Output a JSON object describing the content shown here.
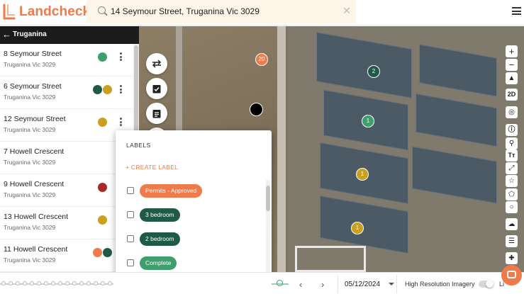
{
  "app": {
    "name": "Landchecker"
  },
  "search": {
    "value": "14 Seymour Street, Truganina Vic 3029",
    "placeholder": ""
  },
  "sidebar": {
    "title": "Truganina",
    "items": [
      {
        "street": "8 Seymour Street",
        "suburb": "Truganina Vic 3029",
        "labels": [
          "#3f9e6d"
        ]
      },
      {
        "street": "6 Seymour Street",
        "suburb": "Truganina Vic 3029",
        "labels": [
          "#1f5a48",
          "#c9a020"
        ]
      },
      {
        "street": "12 Seymour Street",
        "suburb": "Truganina Vic 3029",
        "labels": [
          "#c9a020"
        ]
      },
      {
        "street": "7 Howell Crescent",
        "suburb": "Truganina Vic 3029",
        "labels": []
      },
      {
        "street": "9 Howell Crescent",
        "suburb": "Truganina Vic 3029",
        "labels": [
          "#a72a2a"
        ]
      },
      {
        "street": "13 Howell Crescent",
        "suburb": "Truganina Vic 3029",
        "labels": [
          "#c9a020"
        ]
      },
      {
        "street": "11 Howell Crescent",
        "suburb": "Truganina Vic 3029",
        "labels": [
          "#ef7a4a",
          "#1f5a48"
        ]
      }
    ]
  },
  "labels_popup": {
    "title": "LABELS",
    "create": "+  CREATE LABEL",
    "labels": [
      {
        "name": "Permits - Approved",
        "color": "#ef7a4a"
      },
      {
        "name": "3 bedroom",
        "color": "#1f5a48"
      },
      {
        "name": "2 bedroom",
        "color": "#1f5a48"
      },
      {
        "name": "Complete",
        "color": "#3f9e6d"
      }
    ]
  },
  "map": {
    "markers": [
      {
        "text": "20",
        "color": "#ef7a4a"
      },
      {
        "text": "2",
        "color": "#1f5a48"
      },
      {
        "text": "1",
        "color": "#3f9e6d"
      },
      {
        "text": "1",
        "color": "#c9a020"
      },
      {
        "text": "1",
        "color": "#c9a020"
      },
      {
        "text": "",
        "color": "#000000"
      }
    ],
    "view_mode": "2D"
  },
  "bottombar": {
    "date": "05/12/2024",
    "high_res_label": "High Resolution Imagery",
    "high_res_on": false,
    "right_label": "Li"
  },
  "colors": {
    "accent": "#ef7a4a",
    "dark": "#1b1b1b"
  }
}
